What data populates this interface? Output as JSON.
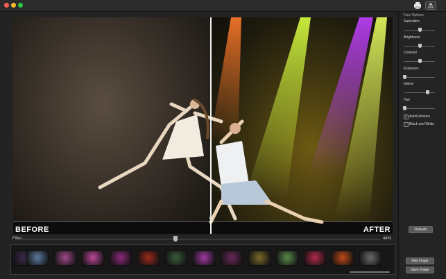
{
  "window": {
    "buttons": [
      "close",
      "minimize",
      "zoom"
    ],
    "toolbar_icons": [
      "print-icon",
      "share-icon"
    ]
  },
  "canvas": {
    "before_label": "BEFORE",
    "after_label": "AFTER"
  },
  "filter": {
    "label": "Filter",
    "value_text": "44%",
    "value": 0.44
  },
  "filters": {
    "count": 14,
    "colors": [
      "#3a2a4a",
      "#5c7a9e",
      "#a04a8a",
      "#c0489a",
      "#8a2a7a",
      "#9a2a1a",
      "#3a5a3a",
      "#a03aa0",
      "#6a2a5a",
      "#7a6a2a",
      "#5a8a4a",
      "#b02a4a",
      "#c04a1a",
      "#6a6a6a"
    ]
  },
  "tune": {
    "title": "Tune Options",
    "sliders": [
      {
        "label": "Saturation",
        "value": 0.5
      },
      {
        "label": "Brightness",
        "value": 0.5
      },
      {
        "label": "Contrast",
        "value": 0.5
      },
      {
        "label": "Exposure",
        "value": 0.0
      },
      {
        "label": "Gama",
        "value": 0.75
      },
      {
        "label": "Hue",
        "value": 0.0
      }
    ],
    "checkboxes": [
      {
        "label": "AutoEnhance",
        "checked": true
      },
      {
        "label": "Black and White",
        "checked": false
      }
    ],
    "defaults_label": "Defaults"
  },
  "actions": {
    "add_label": "Add Image",
    "save_label": "Save Image"
  },
  "colors": {
    "close": "#ff5f57",
    "minimize": "#febc2e",
    "zoom": "#28c840"
  }
}
